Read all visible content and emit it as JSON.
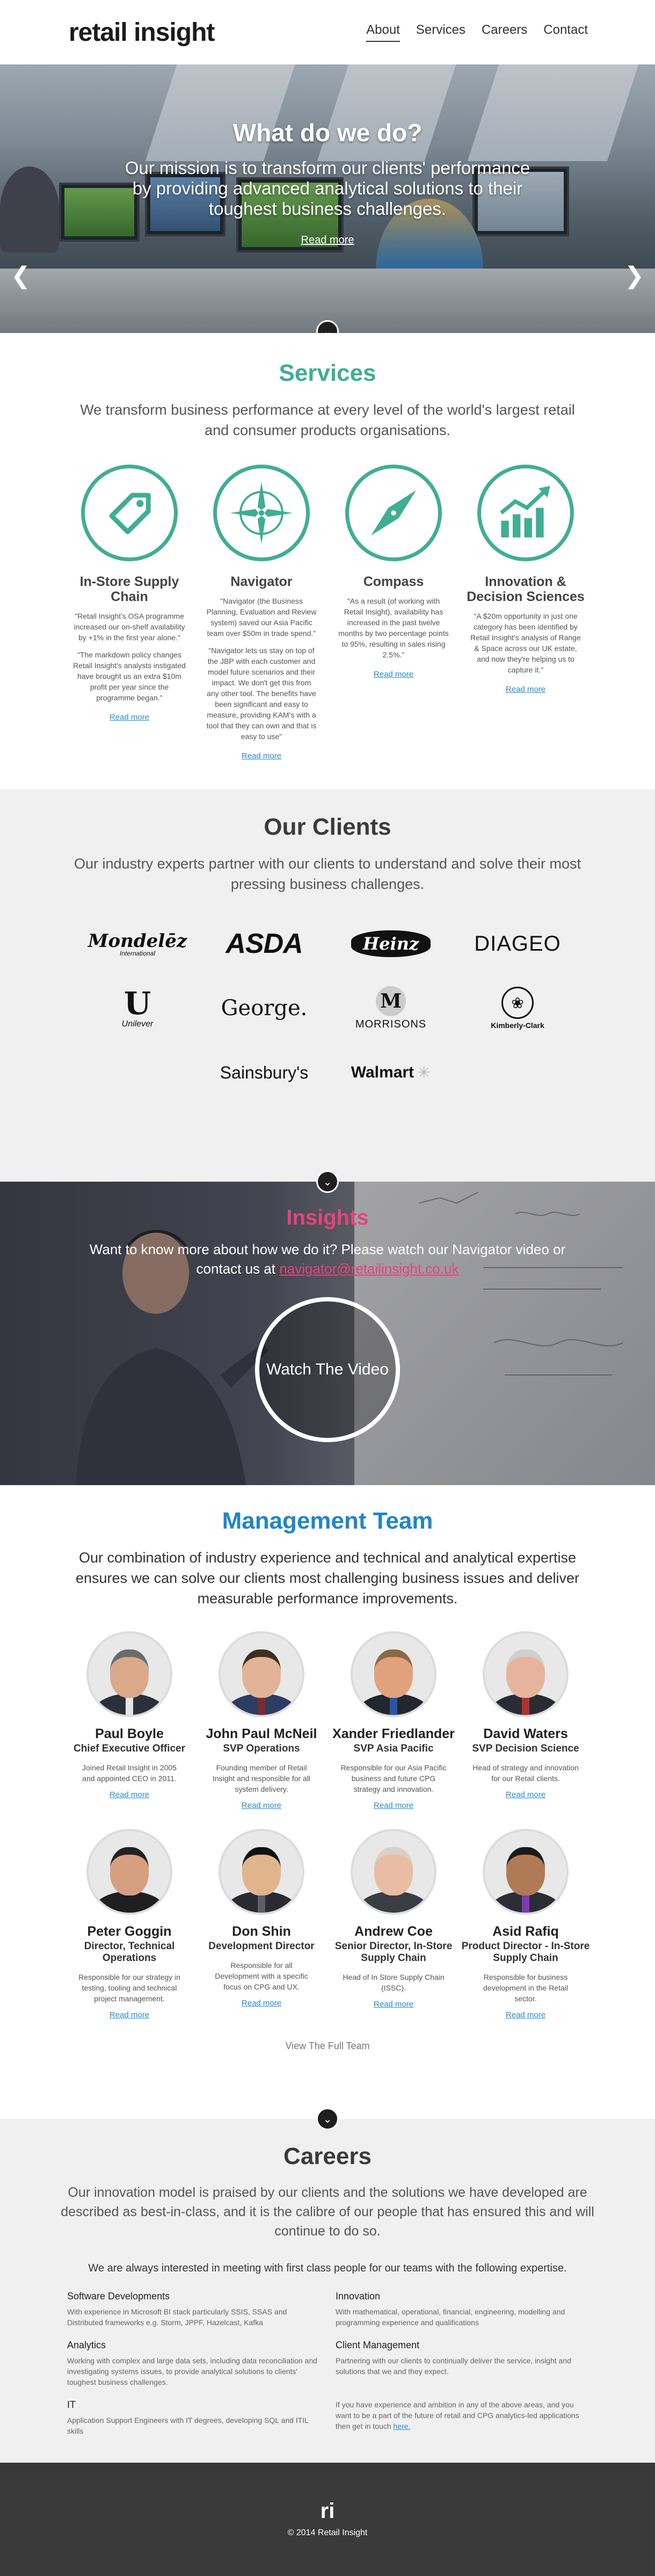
{
  "header": {
    "logo": "retail insight",
    "nav": [
      {
        "label": "About",
        "active": true
      },
      {
        "label": "Services",
        "active": false
      },
      {
        "label": "Careers",
        "active": false
      },
      {
        "label": "Contact",
        "active": false
      }
    ]
  },
  "hero": {
    "title": "What do we do?",
    "text": "Our mission is to transform our clients' performance by providing advanced analytical solutions to their toughest business challenges.",
    "read_more": "Read more",
    "prev_icon": "chevron-left-icon",
    "next_icon": "chevron-right-icon"
  },
  "services": {
    "title": "Services",
    "subtitle": "We transform business performance at every level of the world's largest retail and consumer products organisations.",
    "items": [
      {
        "icon": "tag-icon",
        "title": "In-Store Supply Chain",
        "paragraphs": [
          "\"Retail Insight's OSA programme increased our on-shelf availability by +1% in the first year alone.\"",
          "\"The markdown policy changes Retail Insight's analysts instigated have brought us an extra $10m profit per year since the programme began.\""
        ],
        "link": "Read more"
      },
      {
        "icon": "compass-rose-icon",
        "title": "Navigator",
        "paragraphs": [
          "\"Navigator (the Business Planning, Evaluation and Review system) saved our Asia Pacific team over $50m in trade spend.\"",
          "\"Navigator lets us stay on top of the JBP with each customer and model future scenarios and their impact. We don't get this from any other tool. The benefits have been significant and easy to measure, providing KAM's with a tool that they can own and that is easy to use\""
        ],
        "link": "Read more"
      },
      {
        "icon": "compass-needle-icon",
        "title": "Compass",
        "paragraphs": [
          "\"As a result (of working with Retail Insight), availability has increased in the past twelve months by two percentage points to 95%, resulting in sales rising 2.5%.\""
        ],
        "link": "Read more"
      },
      {
        "icon": "growth-chart-icon",
        "title": "Innovation & Decision Sciences",
        "paragraphs": [
          "\"A $20m opportunity in just one category has been identified by Retail Insight's analysis of Range & Space across our UK estate, and now they're helping us to capture it.\""
        ],
        "link": "Read more"
      }
    ]
  },
  "clients": {
    "title": "Our Clients",
    "subtitle": "Our industry experts partner with our clients to understand and solve their most pressing business challenges.",
    "logos": [
      {
        "name": "mondelez",
        "text": "Mondelēz",
        "sub": "International"
      },
      {
        "name": "asda",
        "text": "ASDA"
      },
      {
        "name": "heinz",
        "text": "Heinz"
      },
      {
        "name": "diageo",
        "text": "DIAGEO"
      },
      {
        "name": "unilever",
        "text": "Unilever"
      },
      {
        "name": "george",
        "text": "George."
      },
      {
        "name": "morrisons",
        "text": "MORRISONS"
      },
      {
        "name": "kimberly-clark",
        "text": "Kimberly-Clark"
      },
      {
        "name": "sainsburys",
        "text": "Sainsbury's"
      },
      {
        "name": "walmart",
        "text": "Walmart"
      }
    ]
  },
  "insights": {
    "title": "Insights",
    "text": "Want to know more about how we do it? Please watch our Navigator video or contact us at ",
    "email": "navigator@retailinsight.co.uk",
    "video_button": "Watch The Video"
  },
  "team": {
    "title": "Management Team",
    "subtitle": "Our combination of industry experience and technical and analytical expertise ensures we can solve our clients most challenging business issues and deliver measurable performance improvements.",
    "members": [
      {
        "name": "Paul Boyle",
        "role": "Chief Executive Officer",
        "bio": "Joined Retail Insight in 2005 and appointed CEO in 2011.",
        "link": "Read more",
        "skin": "#d9a98a",
        "suit": "#2b2f3a",
        "hair": "#6b6b6b",
        "tie": "#e5e5e5"
      },
      {
        "name": "John Paul McNeil",
        "role": "SVP Operations",
        "bio": "Founding member of Retail Insight and responsible for all system delivery.",
        "link": "Read more",
        "skin": "#e2b396",
        "suit": "#2d3c63",
        "hair": "#3d2e22",
        "tie": "#7a2c2c"
      },
      {
        "name": "Xander Friedlander",
        "role": "SVP Asia Pacific",
        "bio": "Responsible for our Asia Pacific business and future CPG strategy and innovation.",
        "link": "Read more",
        "skin": "#dfa27d",
        "suit": "#22262e",
        "hair": "#8a6a44",
        "tie": "#2a56a8"
      },
      {
        "name": "David Waters",
        "role": "SVP Decision Science",
        "bio": "Head of strategy and innovation for our Retail clients.",
        "link": "Read more",
        "skin": "#e6b49c",
        "suit": "#2a2c34",
        "hair": "#cfcfcf",
        "tie": "#b23030"
      },
      {
        "name": "Peter Goggin",
        "role": "Director, Technical Operations",
        "bio": "Responsible for our strategy in testing, tooling and technical project management.",
        "link": "Read more",
        "skin": "#d6a080",
        "suit": "#1f1f22",
        "hair": "#222",
        "tie": "#1f1f22"
      },
      {
        "name": "Don Shin",
        "role": "Development Director",
        "bio": "Responsible for all Development with a specific focus on CPG and UX.",
        "link": "Read more",
        "skin": "#e0b58e",
        "suit": "#2a2a30",
        "hair": "#111",
        "tie": "#5b5f66"
      },
      {
        "name": "Andrew Coe",
        "role": "Senior Director, In-Store Supply Chain",
        "bio": "Head of In Store Supply Chain (ISSC).",
        "link": "Read more",
        "skin": "#e9bca4",
        "suit": "#3a3d44",
        "hair": "#d9d0c8",
        "tie": "#3a3d44"
      },
      {
        "name": "Asid Rafiq",
        "role": "Product Director - In-Store Supply Chain",
        "bio": "Responsible for business development in the Retail sector.",
        "link": "Read more",
        "skin": "#b07a56",
        "suit": "#2a2d36",
        "hair": "#1a1a1a",
        "tie": "#7e3bb0"
      }
    ],
    "view_full_team": "View The Full Team"
  },
  "careers": {
    "title": "Careers",
    "subtitle": "Our innovation model is praised by our clients and the solutions we have developed are described as best-in-class, and it is the calibre of our people that has ensured this and will continue to do so.",
    "lead": "We are always interested in meeting with first class people for our teams with the following expertise.",
    "items": [
      {
        "title": "Software Developments",
        "text": "With experience in Microsoft BI stack particularly SSIS, SSAS and Distributed frameworks e.g. Storm, JPPF, Hazelcast, Kafka"
      },
      {
        "title": "Innovation",
        "text": "With mathematical, operational, financial, engineering, modelling and programming experience and qualifications"
      },
      {
        "title": "Analytics",
        "text": "Working with complex and large data sets, including data reconciliation and investigating systems issues, to provide analytical solutions to clients' toughest business challenges."
      },
      {
        "title": "Client Management",
        "text": "Partnering with our clients to continually deliver the service, insight and solutions that we and they expect."
      },
      {
        "title": "IT",
        "text": "Application Support Engineers with IT degrees, developing SQL and ITIL skills"
      },
      {
        "title": "",
        "text": "If you have experience and ambition in any of the above areas, and you want to be a part of the future of retail and CPG analytics-led applications then get in touch ",
        "link": "here."
      }
    ]
  },
  "footer": {
    "mark": "ri",
    "copyright": "© 2014 Retail Insight"
  },
  "colors": {
    "teal": "#3fae94",
    "blue": "#1f86c7",
    "pink": "#e8427a",
    "footer_bg": "#3a3a3a"
  }
}
